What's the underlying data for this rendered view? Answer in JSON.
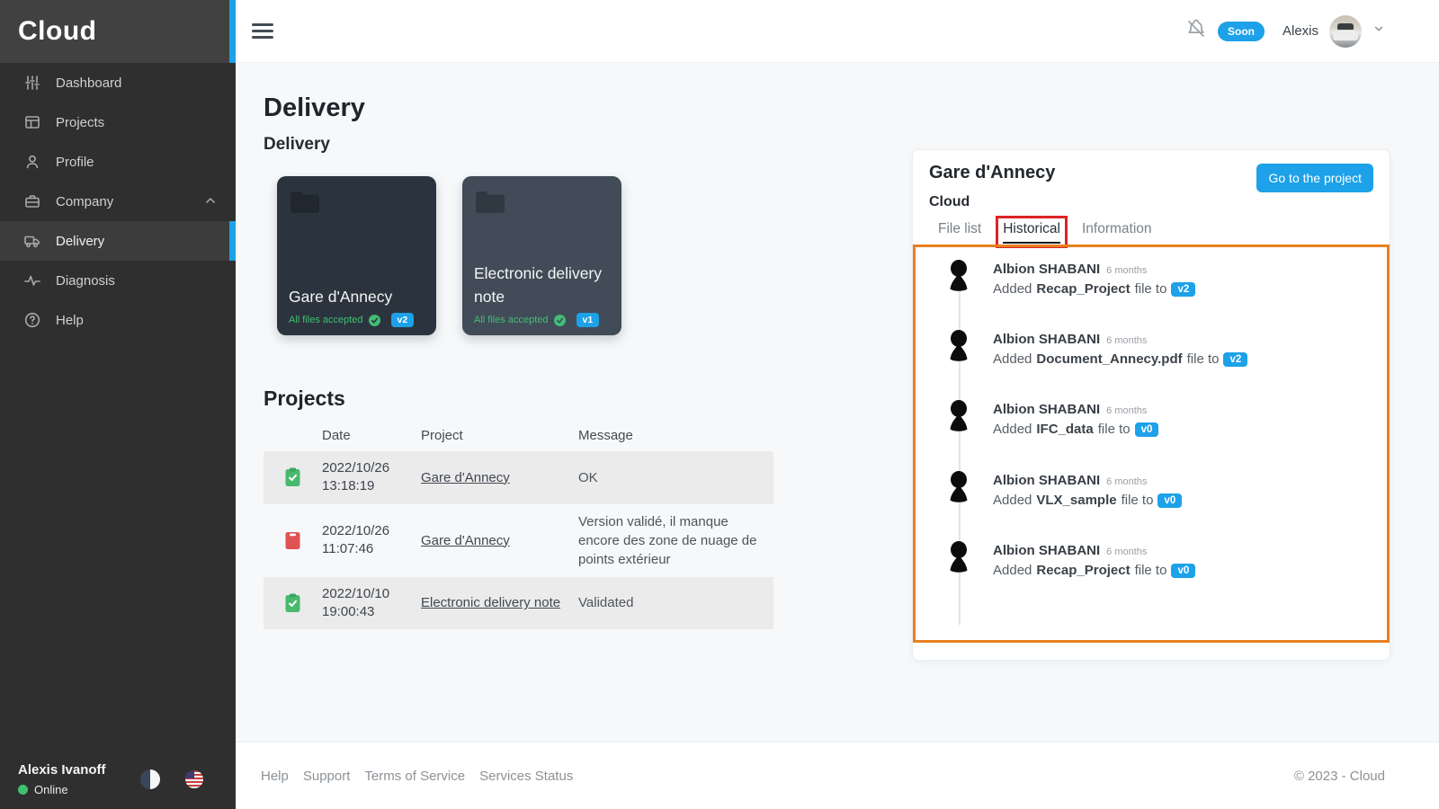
{
  "colors": {
    "accent_blue": "#1da1e8",
    "annotation_orange": "#e8811f",
    "annotation_red": "#dd2323",
    "status_green": "#43bd74",
    "status_red": "#df5353",
    "sidebar_bg": "#2f2f2f"
  },
  "sidebar": {
    "logo": "Cloud",
    "items": [
      {
        "label": "Dashboard",
        "icon": "sliders-icon",
        "active": false
      },
      {
        "label": "Projects",
        "icon": "window-icon",
        "active": false
      },
      {
        "label": "Profile",
        "icon": "person-icon",
        "active": false
      },
      {
        "label": "Company",
        "icon": "briefcase-icon",
        "active": false,
        "chevron": "up"
      },
      {
        "label": "Delivery",
        "icon": "truck-icon",
        "active": true
      },
      {
        "label": "Diagnosis",
        "icon": "pulse-icon",
        "active": false
      },
      {
        "label": "Help",
        "icon": "question-circle-icon",
        "active": false
      }
    ],
    "footer": {
      "name": "Alexis Ivanoff",
      "status": "Online"
    }
  },
  "topbar": {
    "soon_badge": "Soon",
    "username": "Alexis"
  },
  "main": {
    "title": "Delivery",
    "subtitle": "Delivery",
    "cards": [
      {
        "title": "Gare d'Annecy",
        "status": "All files accepted",
        "version": "v2"
      },
      {
        "title": "Electronic delivery note",
        "status": "All files accepted",
        "version": "v1"
      }
    ],
    "projects": {
      "title": "Projects",
      "columns": {
        "date": "Date",
        "project": "Project",
        "message": "Message"
      },
      "rows": [
        {
          "status": "validated",
          "date": "2022/10/26",
          "time": "13:18:19",
          "project": "Gare d'Annecy",
          "message": "OK"
        },
        {
          "status": "rejected",
          "date": "2022/10/26",
          "time": "11:07:46",
          "project": "Gare d'Annecy",
          "message": "Version validé, il manque encore des zone de nuage de points extérieur"
        },
        {
          "status": "validated",
          "date": "2022/10/10",
          "time": "19:00:43",
          "project": "Electronic delivery note",
          "message": "Validated"
        }
      ]
    }
  },
  "panel": {
    "title": "Gare d'Annecy",
    "subtitle": "Cloud",
    "button": "Go to the project",
    "tabs": [
      {
        "label": "File list",
        "active": false
      },
      {
        "label": "Historical",
        "active": true
      },
      {
        "label": "Information",
        "active": false
      }
    ],
    "timeline": [
      {
        "user": "Albion SHABANI",
        "time": "6 months",
        "action": "Added",
        "file": "Recap_Project",
        "suffix": "file to",
        "version": "v2"
      },
      {
        "user": "Albion SHABANI",
        "time": "6 months",
        "action": "Added",
        "file": "Document_Annecy.pdf",
        "suffix": "file to",
        "version": "v2"
      },
      {
        "user": "Albion SHABANI",
        "time": "6 months",
        "action": "Added",
        "file": "IFC_data",
        "suffix": "file to",
        "version": "v0"
      },
      {
        "user": "Albion SHABANI",
        "time": "6 months",
        "action": "Added",
        "file": "VLX_sample",
        "suffix": "file to",
        "version": "v0"
      },
      {
        "user": "Albion SHABANI",
        "time": "6 months",
        "action": "Added",
        "file": "Recap_Project",
        "suffix": "file to",
        "version": "v0"
      }
    ]
  },
  "footer": {
    "links": [
      "Help",
      "Support",
      "Terms of Service",
      "Services Status"
    ],
    "copyright": "© 2023 - Cloud"
  }
}
